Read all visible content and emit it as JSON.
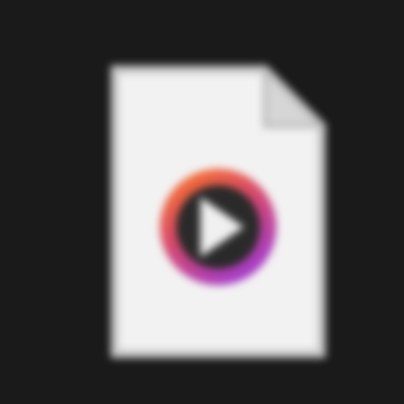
{
  "icon": {
    "name": "media-file-icon",
    "badge": "play-icon",
    "colors": {
      "background": "#1a1a1a",
      "page_fill": "#f2f2f2",
      "page_outline": "#c8c8c8",
      "fold": "#d6d6d6",
      "ring_top": "#ff7a1e",
      "ring_bottom": "#a63cc8",
      "disc": "#2a2a2a",
      "play": "#f0f0f0"
    }
  }
}
